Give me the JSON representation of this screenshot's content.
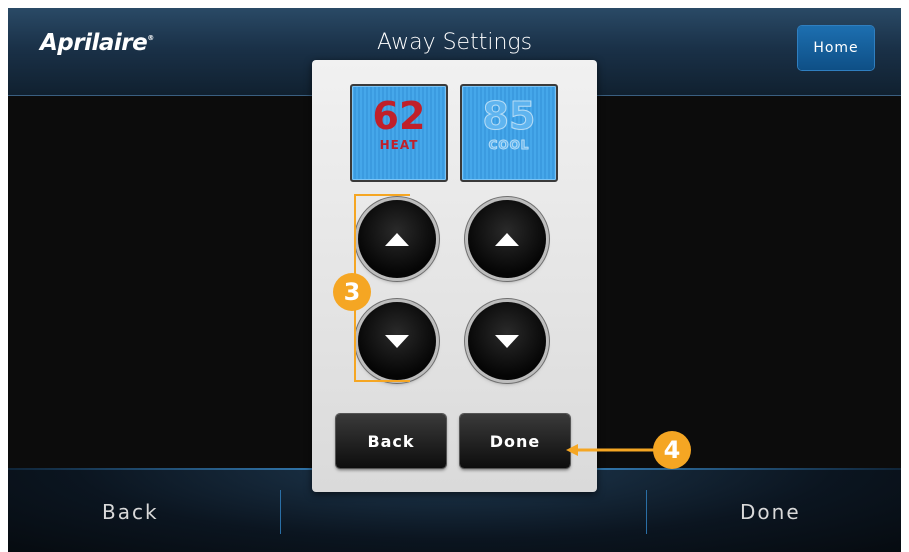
{
  "header": {
    "brand": "Aprilaire",
    "brand_mark": "®",
    "title": "Away Settings",
    "home_label": "Home"
  },
  "dialog": {
    "heat": {
      "value": "62",
      "label": "HEAT"
    },
    "cool": {
      "value": "85",
      "label": "COOL"
    },
    "back_label": "Back",
    "done_label": "Done"
  },
  "softkeys": {
    "back_label": "Back",
    "done_label": "Done"
  },
  "annotations": {
    "step3": "3",
    "step4": "4"
  },
  "icons": [
    "up-arrow-icon",
    "down-arrow-icon"
  ],
  "colors": {
    "accent": "#f5a623",
    "heat": "#c0202a",
    "cool": "#5fb4ef",
    "home_button": "#1d6fb0"
  }
}
